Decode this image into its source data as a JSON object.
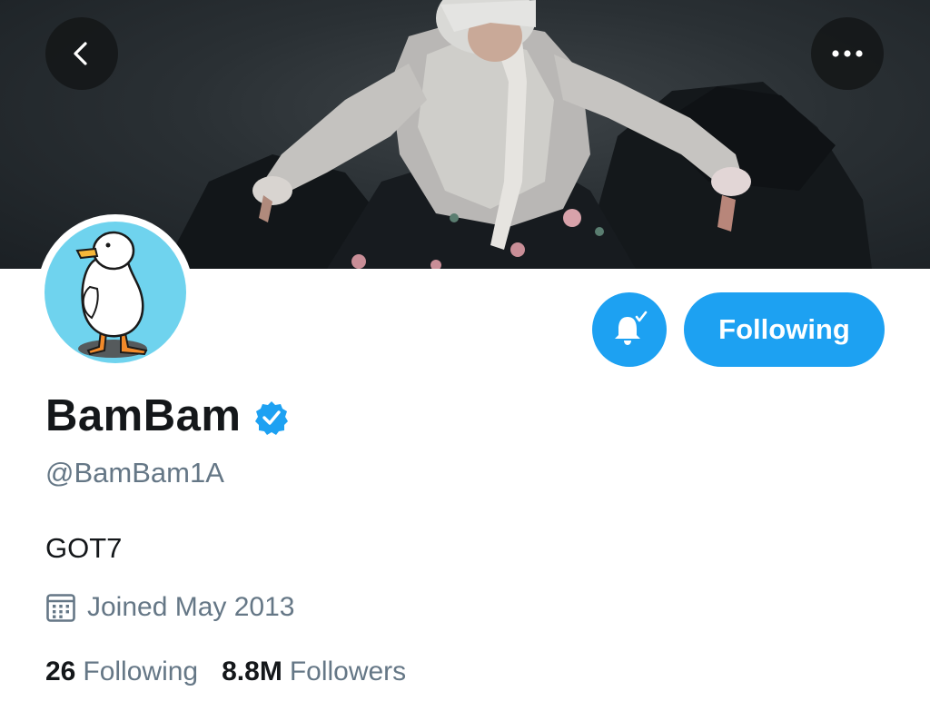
{
  "header": {
    "back_icon": "chevron-left-icon",
    "more_icon": "ellipsis-icon",
    "banner_image": "profile banner photo"
  },
  "profile": {
    "display_name": "BamBam",
    "verified_icon": "verified-badge-icon",
    "handle": "@BamBam1A",
    "bio": "GOT7",
    "joined": "Joined May 2013",
    "avatar_icon": "duck-avatar"
  },
  "actions": {
    "notify_icon": "bell-check-icon",
    "follow_label": "Following"
  },
  "stats": {
    "following_count": "26",
    "following_label": "Following",
    "followers_count": "8.8M",
    "followers_label": "Followers"
  },
  "colors": {
    "accent": "#1da1f2",
    "text_primary": "#14171a",
    "text_secondary": "#657786",
    "avatar_bg": "#6fd3ee"
  }
}
